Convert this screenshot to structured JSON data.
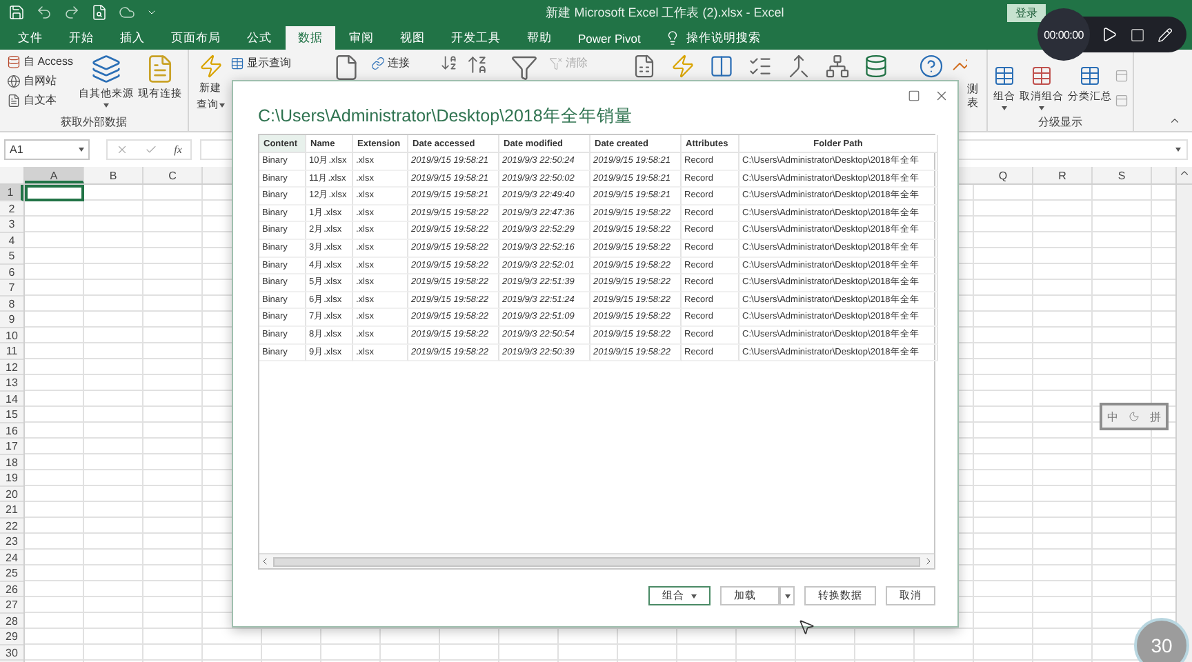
{
  "window": {
    "title": "新建 Microsoft Excel 工作表 (2).xlsx  -  Excel",
    "sign_in": "登录"
  },
  "ribbon_tabs": [
    {
      "label": "文件",
      "selected": false
    },
    {
      "label": "开始",
      "selected": false
    },
    {
      "label": "插入",
      "selected": false
    },
    {
      "label": "页面布局",
      "selected": false
    },
    {
      "label": "公式",
      "selected": false
    },
    {
      "label": "数据",
      "selected": true
    },
    {
      "label": "审阅",
      "selected": false
    },
    {
      "label": "视图",
      "selected": false
    },
    {
      "label": "开发工具",
      "selected": false
    },
    {
      "label": "帮助",
      "selected": false
    },
    {
      "label": "Power Pivot",
      "selected": false
    }
  ],
  "tell_me": "操作说明搜索",
  "ribbon_left": {
    "group_label": "获取外部数据",
    "small_buttons": [
      "自 Access",
      "自网站",
      "自文本"
    ],
    "large_buttons": [
      {
        "label": "自其他来源",
        "dropdown": true
      },
      {
        "label": "现有连接",
        "dropdown": false
      }
    ],
    "new_query": {
      "lines": [
        "新建",
        "查询"
      ],
      "dropdown": true
    }
  },
  "ribbon_middle": [
    {
      "label": "显示查询",
      "disabled": false
    },
    {
      "label": "连接",
      "disabled": false
    },
    {
      "label": "清除",
      "disabled": true
    }
  ],
  "ribbon_right": {
    "cut_label_lines": [
      "测",
      "表"
    ],
    "group_label": "分级显示",
    "buttons": [
      {
        "label": "组合",
        "dropdown": true
      },
      {
        "label": "取消组合",
        "dropdown": true
      },
      {
        "label": "分类汇总",
        "dropdown": false
      }
    ]
  },
  "formula_bar": {
    "name_box": "A1",
    "function_label": "fx"
  },
  "sheet": {
    "columns_left": [
      {
        "label": "A",
        "selected": true
      },
      {
        "label": "B",
        "selected": false
      },
      {
        "label": "C",
        "selected": false
      }
    ],
    "columns_right": [
      {
        "label": "Q",
        "selected": false
      },
      {
        "label": "R",
        "selected": false
      },
      {
        "label": "S",
        "selected": false
      }
    ],
    "rows": [
      {
        "label": "1",
        "selected": true
      },
      {
        "label": "2",
        "selected": false
      },
      {
        "label": "3",
        "selected": false
      },
      {
        "label": "4",
        "selected": false
      },
      {
        "label": "5",
        "selected": false
      },
      {
        "label": "6",
        "selected": false
      },
      {
        "label": "7",
        "selected": false
      },
      {
        "label": "8",
        "selected": false
      },
      {
        "label": "9",
        "selected": false
      },
      {
        "label": "10",
        "selected": false
      },
      {
        "label": "11",
        "selected": false
      },
      {
        "label": "12",
        "selected": false
      },
      {
        "label": "13",
        "selected": false
      },
      {
        "label": "14",
        "selected": false
      },
      {
        "label": "15",
        "selected": false
      },
      {
        "label": "16",
        "selected": false
      },
      {
        "label": "17",
        "selected": false
      },
      {
        "label": "18",
        "selected": false
      },
      {
        "label": "19",
        "selected": false
      },
      {
        "label": "20",
        "selected": false
      },
      {
        "label": "21",
        "selected": false
      },
      {
        "label": "22",
        "selected": false
      },
      {
        "label": "23",
        "selected": false
      },
      {
        "label": "24",
        "selected": false
      },
      {
        "label": "25",
        "selected": false
      },
      {
        "label": "26",
        "selected": false
      },
      {
        "label": "27",
        "selected": false
      },
      {
        "label": "28",
        "selected": false
      },
      {
        "label": "29",
        "selected": false
      },
      {
        "label": "30",
        "selected": false
      }
    ]
  },
  "dialog": {
    "title": "C:\\Users\\Administrator\\Desktop\\2018年全年销量",
    "table": {
      "columns": [
        "Content",
        "Name",
        "Extension",
        "Date accessed",
        "Date modified",
        "Date created",
        "Attributes",
        "Folder Path"
      ],
      "rows": [
        [
          "Binary",
          "10月.xlsx",
          ".xlsx",
          "2019/9/15 19:58:21",
          "2019/9/3 22:50:24",
          "2019/9/15 19:58:21",
          "Record",
          "C:\\Users\\Administrator\\Desktop\\2018年全年"
        ],
        [
          "Binary",
          "11月.xlsx",
          ".xlsx",
          "2019/9/15 19:58:21",
          "2019/9/3 22:50:02",
          "2019/9/15 19:58:21",
          "Record",
          "C:\\Users\\Administrator\\Desktop\\2018年全年"
        ],
        [
          "Binary",
          "12月.xlsx",
          ".xlsx",
          "2019/9/15 19:58:21",
          "2019/9/3 22:49:40",
          "2019/9/15 19:58:21",
          "Record",
          "C:\\Users\\Administrator\\Desktop\\2018年全年"
        ],
        [
          "Binary",
          "1月.xlsx",
          ".xlsx",
          "2019/9/15 19:58:22",
          "2019/9/3 22:47:36",
          "2019/9/15 19:58:22",
          "Record",
          "C:\\Users\\Administrator\\Desktop\\2018年全年"
        ],
        [
          "Binary",
          "2月.xlsx",
          ".xlsx",
          "2019/9/15 19:58:22",
          "2019/9/3 22:52:29",
          "2019/9/15 19:58:22",
          "Record",
          "C:\\Users\\Administrator\\Desktop\\2018年全年"
        ],
        [
          "Binary",
          "3月.xlsx",
          ".xlsx",
          "2019/9/15 19:58:22",
          "2019/9/3 22:52:16",
          "2019/9/15 19:58:22",
          "Record",
          "C:\\Users\\Administrator\\Desktop\\2018年全年"
        ],
        [
          "Binary",
          "4月.xlsx",
          ".xlsx",
          "2019/9/15 19:58:22",
          "2019/9/3 22:52:01",
          "2019/9/15 19:58:22",
          "Record",
          "C:\\Users\\Administrator\\Desktop\\2018年全年"
        ],
        [
          "Binary",
          "5月.xlsx",
          ".xlsx",
          "2019/9/15 19:58:22",
          "2019/9/3 22:51:39",
          "2019/9/15 19:58:22",
          "Record",
          "C:\\Users\\Administrator\\Desktop\\2018年全年"
        ],
        [
          "Binary",
          "6月.xlsx",
          ".xlsx",
          "2019/9/15 19:58:22",
          "2019/9/3 22:51:24",
          "2019/9/15 19:58:22",
          "Record",
          "C:\\Users\\Administrator\\Desktop\\2018年全年"
        ],
        [
          "Binary",
          "7月.xlsx",
          ".xlsx",
          "2019/9/15 19:58:22",
          "2019/9/3 22:51:09",
          "2019/9/15 19:58:22",
          "Record",
          "C:\\Users\\Administrator\\Desktop\\2018年全年"
        ],
        [
          "Binary",
          "8月.xlsx",
          ".xlsx",
          "2019/9/15 19:58:22",
          "2019/9/3 22:50:54",
          "2019/9/15 19:58:22",
          "Record",
          "C:\\Users\\Administrator\\Desktop\\2018年全年"
        ],
        [
          "Binary",
          "9月.xlsx",
          ".xlsx",
          "2019/9/15 19:58:22",
          "2019/9/3 22:50:39",
          "2019/9/15 19:58:22",
          "Record",
          "C:\\Users\\Administrator\\Desktop\\2018年全年"
        ]
      ]
    },
    "buttons": [
      {
        "label": "组合",
        "kind": "dropdown",
        "focused": true
      },
      {
        "label": "加载",
        "kind": "split",
        "focused": false
      },
      {
        "label": "转换数据",
        "kind": "plain",
        "focused": false
      },
      {
        "label": "取消",
        "kind": "plain",
        "focused": false
      }
    ]
  },
  "recorder": {
    "time": "00:00:00"
  },
  "ime": {
    "mode": "中",
    "input": "拼"
  },
  "badge": "30"
}
